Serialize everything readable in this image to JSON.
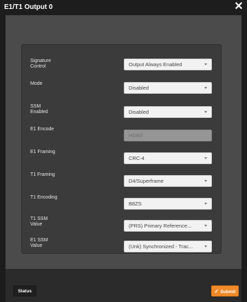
{
  "dialog": {
    "title": "E1/T1 Output 0",
    "close_glyph": "✕"
  },
  "fields": [
    {
      "label_line1": "Signature",
      "label_line2": "Control",
      "value": "Output Always Enabled",
      "disabled": false
    },
    {
      "label_line1": "Mode",
      "label_line2": "",
      "value": "Disabled",
      "disabled": false
    },
    {
      "label_line1": "SSM",
      "label_line2": "Enabled",
      "value": "Disabled",
      "disabled": false
    },
    {
      "label_line1": "E1 Encode",
      "label_line2": "",
      "value": "HDB3",
      "disabled": true
    },
    {
      "label_line1": "E1 Framing",
      "label_line2": "",
      "value": "CRC-4",
      "disabled": false
    },
    {
      "label_line1": "T1 Framing",
      "label_line2": "",
      "value": "D4/Superframe",
      "disabled": false
    },
    {
      "label_line1": "T1 Encoding",
      "label_line2": "",
      "value": "B8ZS",
      "disabled": false
    },
    {
      "label_line1": "T1 SSM",
      "label_line2": "Value",
      "value": "(PRS) Primary Reference...",
      "disabled": false
    },
    {
      "label_line1": "E1 SSM",
      "label_line2": "Value",
      "value": "(Unk) Synchronized - Trac...",
      "disabled": false
    }
  ],
  "footer": {
    "status_label": "Status",
    "submit_label": "Submit",
    "submit_icon": "check-icon"
  },
  "colors": {
    "submit": "#f08a2b",
    "panel": "#3b3b3b",
    "background": "#4b4b4b"
  }
}
